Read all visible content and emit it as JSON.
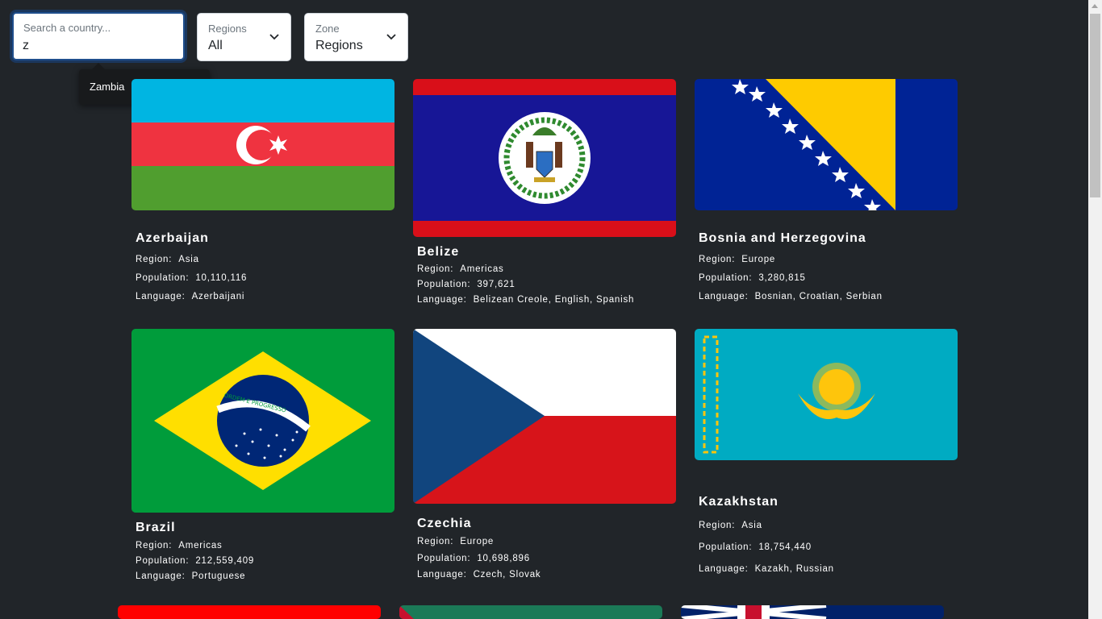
{
  "search": {
    "placeholder": "Search a country...",
    "value": "z"
  },
  "suggestions": [
    "Zambia"
  ],
  "region_select": {
    "label": "Regions",
    "value": "All"
  },
  "zone_select": {
    "label": "Zone",
    "value": "Regions"
  },
  "field_labels": {
    "region": "Region:",
    "population": "Population:",
    "language": "Language:"
  },
  "countries": [
    {
      "name": "Azerbaijan",
      "region": "Asia",
      "population": "10,110,116",
      "language": "Azerbaijani"
    },
    {
      "name": "Belize",
      "region": "Americas",
      "population": "397,621",
      "language": "Belizean  Creole,  English,  Spanish"
    },
    {
      "name": "Bosnia  and  Herzegovina",
      "region": "Europe",
      "population": "3,280,815",
      "language": "Bosnian,  Croatian,  Serbian"
    },
    {
      "name": "Brazil",
      "region": "Americas",
      "population": "212,559,409",
      "language": "Portuguese"
    },
    {
      "name": "Czechia",
      "region": "Europe",
      "population": "10,698,896",
      "language": "Czech,  Slovak"
    },
    {
      "name": "Kazakhstan",
      "region": "Asia",
      "population": "18,754,440",
      "language": "Kazakh,  Russian"
    }
  ],
  "flag_texts": {
    "brazil_motto": "ORDEM E PROGRESSO"
  }
}
